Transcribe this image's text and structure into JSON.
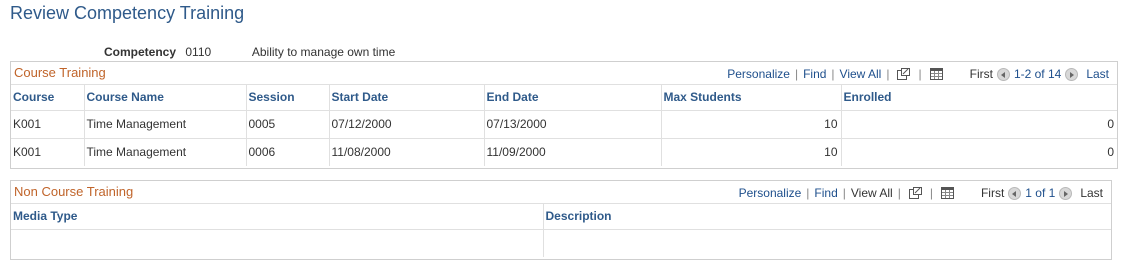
{
  "page": {
    "title": "Review Competency Training"
  },
  "competency": {
    "label": "Competency",
    "code": "0110",
    "description": "Ability to manage own time"
  },
  "course_training": {
    "title": "Course Training",
    "nav": {
      "personalize": "Personalize",
      "find": "Find",
      "view_all": "View All",
      "first": "First",
      "count": "1-2 of 14",
      "last": "Last"
    },
    "columns": [
      "Course",
      "Course Name",
      "Session",
      "Start Date",
      "End Date",
      "Max Students",
      "Enrolled"
    ],
    "rows": [
      [
        "K001",
        "Time Management",
        "0005",
        "07/12/2000",
        "07/13/2000",
        "10",
        "0"
      ],
      [
        "K001",
        "Time Management",
        "0006",
        "11/08/2000",
        "11/09/2000",
        "10",
        "0"
      ]
    ]
  },
  "non_course_training": {
    "title": "Non Course Training",
    "nav": {
      "personalize": "Personalize",
      "find": "Find",
      "view_all": "View All",
      "first": "First",
      "count": "1 of 1",
      "last": "Last"
    },
    "columns": [
      "Media Type",
      "Description"
    ],
    "rows": [
      [
        "",
        ""
      ]
    ]
  },
  "icons": {
    "zoom": "new-window-icon",
    "download": "grid-download-icon"
  },
  "colors": {
    "title": "#2f5a8a",
    "grid_title": "#c0642a",
    "link": "#1e4f8c"
  }
}
